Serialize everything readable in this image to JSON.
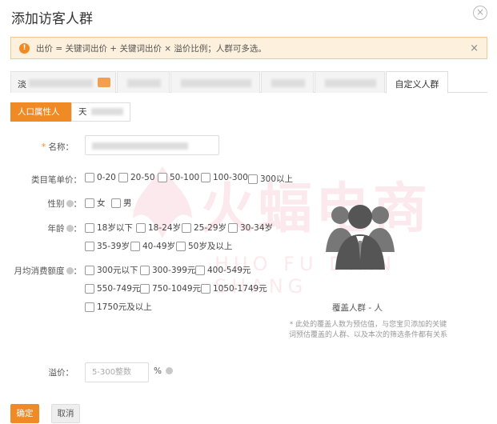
{
  "dialog": {
    "title": "添加访客人群",
    "close_icon": "×"
  },
  "alert": {
    "icon": "!",
    "text": "出价 = 关键词出价 + 关键词出价 × 溢价比例；人群可多选。",
    "close_icon": "×"
  },
  "tabs": [
    {
      "label": "淡"
    },
    {
      "label": ""
    },
    {
      "label": ""
    },
    {
      "label": ""
    },
    {
      "label": ""
    },
    {
      "label": "自定义人群",
      "active": true
    }
  ],
  "subtabs": [
    {
      "label": "人口属性人群",
      "active": true
    },
    {
      "label": "天"
    }
  ],
  "form": {
    "name_required": "*",
    "name_label": "名称：",
    "price_label": "类目笔单价：",
    "price_options": [
      "0-20",
      "20-50",
      "50-100",
      "100-300",
      "300以上"
    ],
    "gender_label": "性别",
    "gender_colon": "：",
    "gender_options": [
      "女",
      "男"
    ],
    "age_label": "年龄",
    "age_colon": "：",
    "age_options": [
      "18岁以下",
      "18-24岁",
      "25-29岁",
      "30-34岁",
      "35-39岁",
      "40-49岁",
      "50岁及以上"
    ],
    "spend_label": "月均消费额度",
    "spend_colon": "：",
    "spend_options": [
      "300元以下",
      "300-399元",
      "400-549元",
      "550-749元",
      "750-1049元",
      "1050-1749元",
      "1750元及以上"
    ],
    "premium_label": "溢价：",
    "premium_placeholder": "5-300整数",
    "premium_unit": "%"
  },
  "coverage": {
    "text": "覆盖人群 - 人",
    "note": "* 此处的覆盖人数为预估值，与您宝贝添加的关键词预估覆盖的人群、以及本次的筛选条件都有关系"
  },
  "watermark": {
    "main": "火蝠电商",
    "sub": "HUO FU DIAN SHANG"
  },
  "actions": {
    "confirm": "确定",
    "cancel": "取消"
  },
  "colors": {
    "accent": "#f08a24",
    "alert_bg": "#fdf0dc"
  }
}
